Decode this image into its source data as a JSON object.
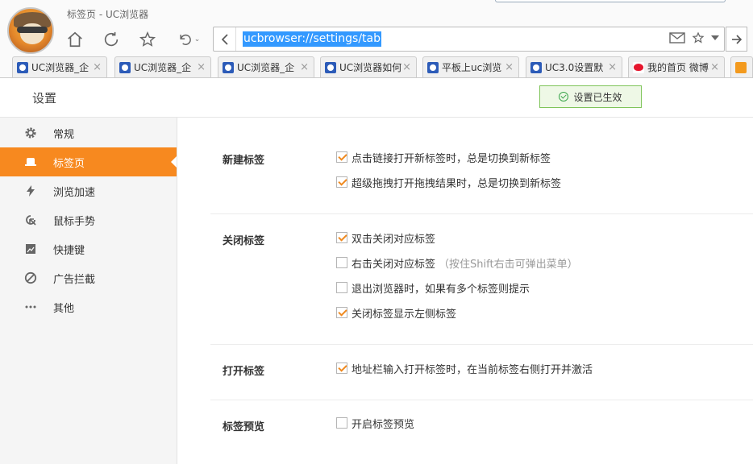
{
  "window": {
    "title": "标签页 - UC浏览器"
  },
  "toolbar": {
    "address_url": "ucbrowser://settings/tab"
  },
  "tabs": [
    {
      "label": "UC浏览器_企",
      "favicon": "paw-icon"
    },
    {
      "label": "UC浏览器_企",
      "favicon": "paw-icon"
    },
    {
      "label": "UC浏览器_企",
      "favicon": "paw-icon"
    },
    {
      "label": "UC浏览器如何",
      "favicon": "paw-icon"
    },
    {
      "label": "平板上uc浏览",
      "favicon": "paw-icon"
    },
    {
      "label": "UC3.0设置默",
      "favicon": "paw-icon"
    },
    {
      "label": "我的首页 微博",
      "favicon": "weibo-icon"
    }
  ],
  "settings": {
    "title": "设置",
    "toast": "设置已生效"
  },
  "sidebar": {
    "items": [
      {
        "label": "常规",
        "icon": "gear-icon",
        "active": false
      },
      {
        "label": "标签页",
        "icon": "tab-icon",
        "active": true
      },
      {
        "label": "浏览加速",
        "icon": "lightning-icon",
        "active": false
      },
      {
        "label": "鼠标手势",
        "icon": "mouse-gesture-icon",
        "active": false
      },
      {
        "label": "快捷键",
        "icon": "shortcut-icon",
        "active": false
      },
      {
        "label": "广告拦截",
        "icon": "block-icon",
        "active": false
      },
      {
        "label": "其他",
        "icon": "more-icon",
        "active": false
      }
    ]
  },
  "sections": {
    "new_tab": {
      "label": "新建标签",
      "options": [
        {
          "text": "点击链接打开新标签时，总是切换到新标签",
          "checked": true
        },
        {
          "text": "超级拖拽打开拖拽结果时，总是切换到新标签",
          "checked": true
        }
      ]
    },
    "close_tab": {
      "label": "关闭标签",
      "options": [
        {
          "text": "双击关闭对应标签",
          "checked": true
        },
        {
          "text": "右击关闭对应标签",
          "hint": "（按住Shift右击可弹出菜单）",
          "checked": false
        },
        {
          "text": "退出浏览器时，如果有多个标签则提示",
          "checked": false
        },
        {
          "text": "关闭标签显示左侧标签",
          "checked": true
        }
      ]
    },
    "open_tab": {
      "label": "打开标签",
      "options": [
        {
          "text": "地址栏输入打开标签时，在当前标签右侧打开并激活",
          "checked": true
        }
      ]
    },
    "preview_tab": {
      "label": "标签预览",
      "options": [
        {
          "text": "开启标签预览",
          "checked": false
        }
      ]
    }
  },
  "colors": {
    "accent": "#f7891f",
    "sidebar_bg": "#f5f5f5",
    "toast_bg": "#eef8e6",
    "url_selection": "#3399ff"
  }
}
